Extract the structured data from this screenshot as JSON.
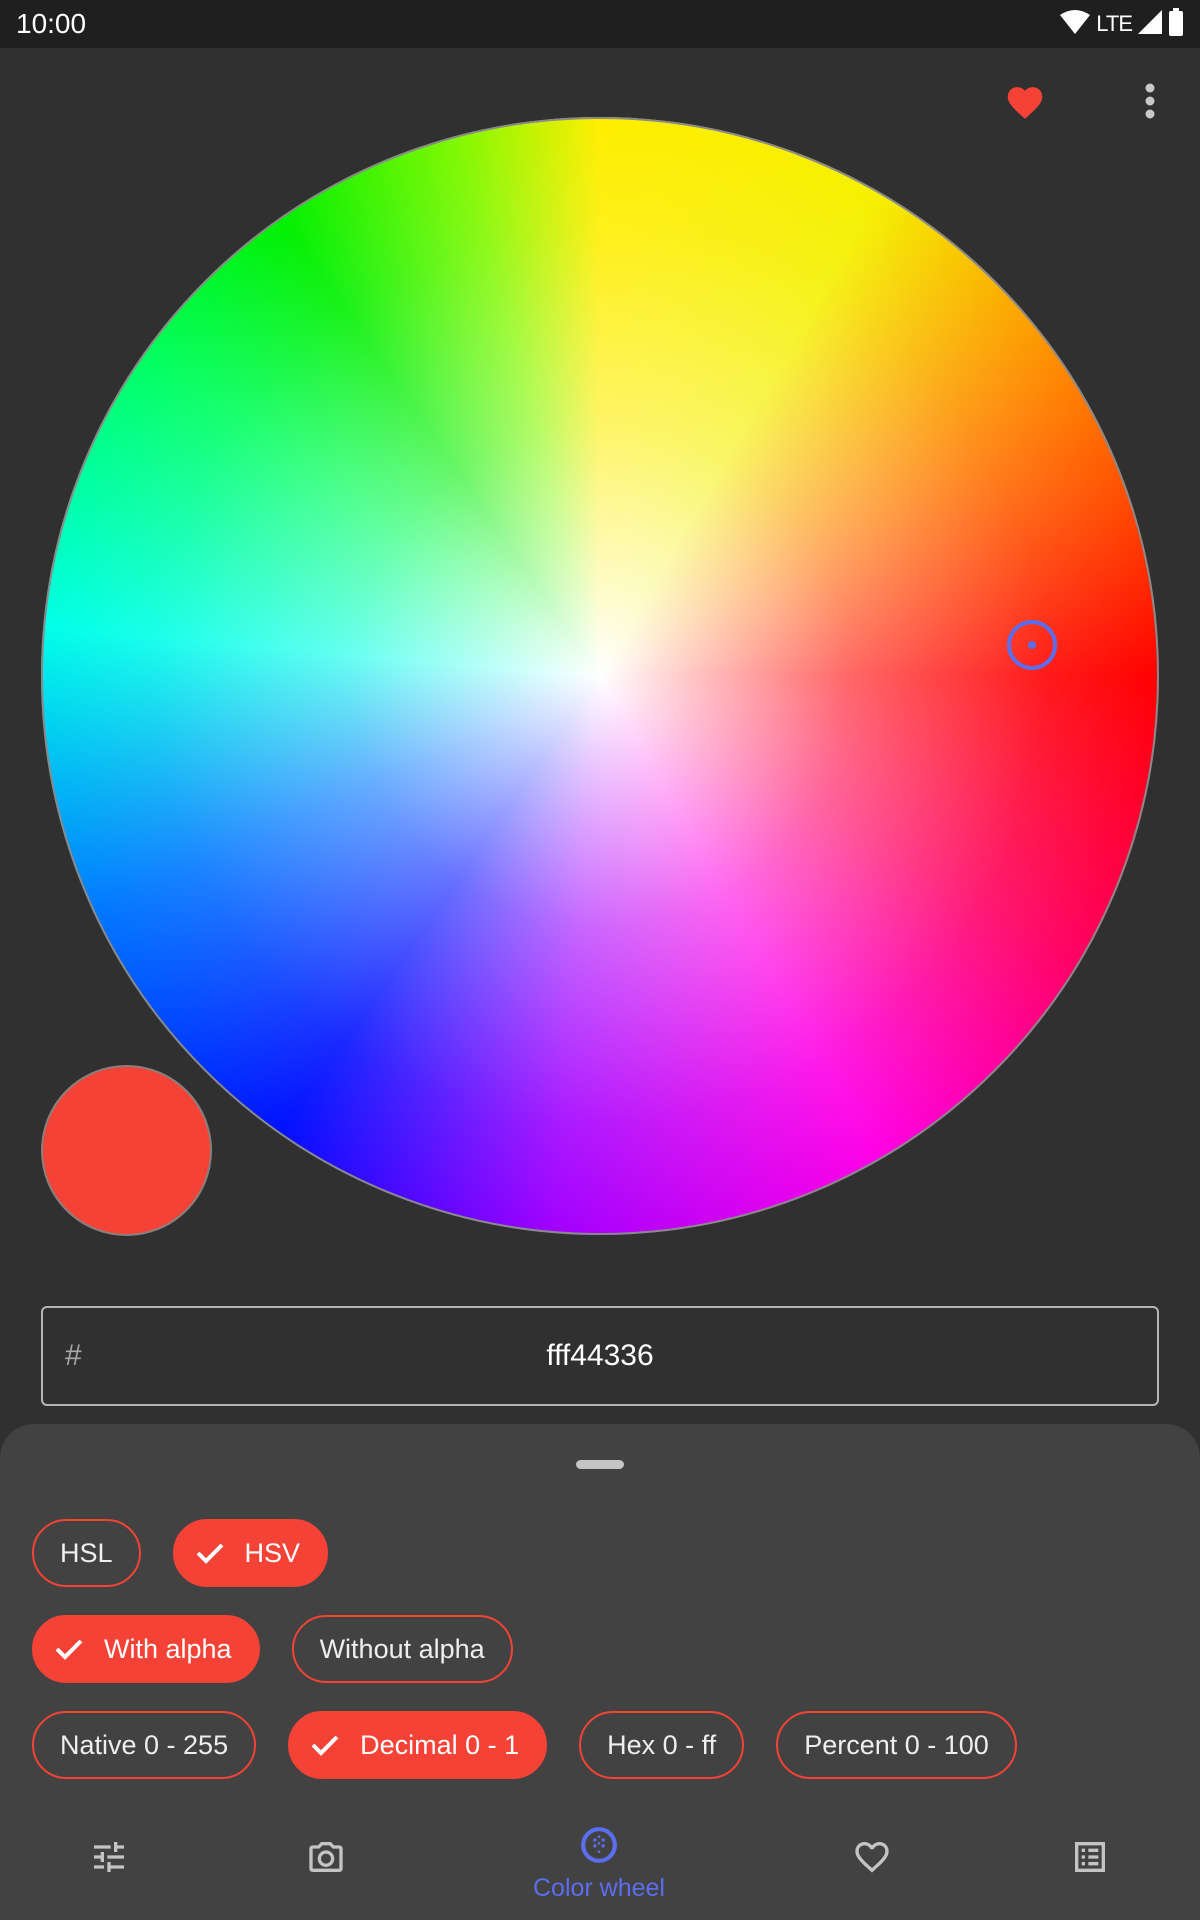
{
  "status_bar": {
    "time": "10:00",
    "network": "LTE",
    "icons": [
      "wifi-icon",
      "signal-icon",
      "battery-icon"
    ]
  },
  "top_actions": {
    "favorite_icon": "heart-filled-icon",
    "menu_icon": "more-vertical-icon"
  },
  "color_wheel": {
    "selected_color": "#f44336",
    "handle_color": "#5b6ef0"
  },
  "swatch": {
    "color": "#f44336"
  },
  "hex_field": {
    "prefix": "#",
    "value": "fff44336"
  },
  "sheet": {
    "model_chips": [
      {
        "label": "HSL",
        "selected": false
      },
      {
        "label": "HSV",
        "selected": true
      }
    ],
    "alpha_chips": [
      {
        "label": "With alpha",
        "selected": true
      },
      {
        "label": "Without alpha",
        "selected": false
      }
    ],
    "format_chips": [
      {
        "label": "Native 0 - 255",
        "selected": false
      },
      {
        "label": "Decimal 0 - 1",
        "selected": true
      },
      {
        "label": "Hex 0 - ff",
        "selected": false
      },
      {
        "label": "Percent 0 - 100",
        "selected": false
      }
    ]
  },
  "bottom_nav": {
    "items": [
      {
        "icon": "sliders-icon",
        "label": "",
        "active": false
      },
      {
        "icon": "camera-icon",
        "label": "",
        "active": false
      },
      {
        "icon": "color-wheel-icon",
        "label": "Color wheel",
        "active": true
      },
      {
        "icon": "heart-outline-icon",
        "label": "",
        "active": false
      },
      {
        "icon": "list-icon",
        "label": "",
        "active": false
      }
    ]
  },
  "colors": {
    "accent": "#f44336",
    "active_nav": "#5b6ef0",
    "background": "#303030",
    "sheet": "#424242"
  }
}
